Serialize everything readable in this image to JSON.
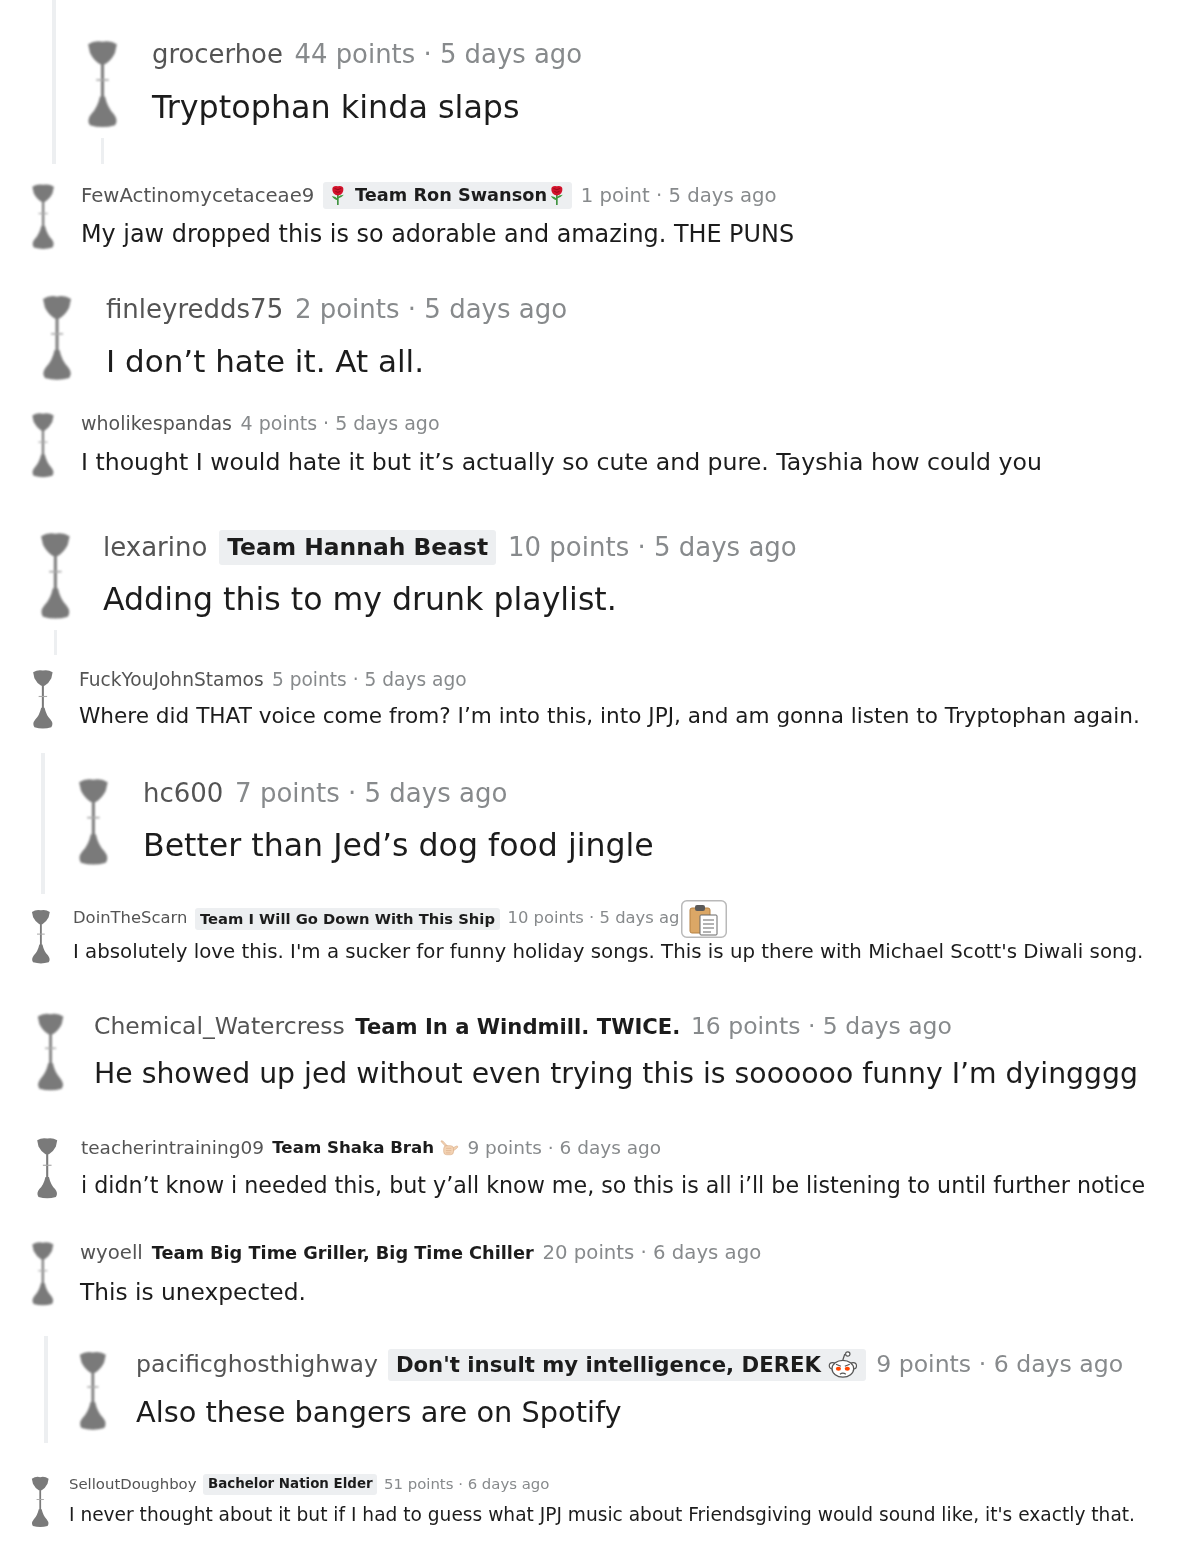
{
  "comments": [
    {
      "username": "grocerhoe",
      "meta": "44 points · 5 days ago",
      "text": "Tryptophan kinda slaps",
      "thread_line": true,
      "reply_line": true,
      "clipboard_popup": false
    },
    {
      "username": "FewActinomycetaceae9",
      "flair": {
        "text": "Team Ron Swanson",
        "badge": true,
        "icons_before": [
          {
            "kind": "rose"
          }
        ],
        "icons_after": [
          {
            "kind": "rose"
          }
        ]
      },
      "meta": "1 point · 5 days ago",
      "text": "My jaw dropped this is so adorable and amazing. THE PUNS",
      "thread_line": false,
      "reply_line": false,
      "clipboard_popup": false
    },
    {
      "username": "finleyredds75",
      "meta": "2 points · 5 days ago",
      "text": "I don’t hate it. At all.",
      "thread_line": false,
      "reply_line": false,
      "clipboard_popup": false
    },
    {
      "username": "wholikespandas",
      "meta": "4 points · 5 days ago",
      "text": "I thought I would hate it but it’s actually so cute and pure. Tayshia how could you",
      "thread_line": false,
      "reply_line": false,
      "clipboard_popup": false
    },
    {
      "username": "lexarino",
      "flair": {
        "text": "Team Hannah Beast",
        "badge": true
      },
      "meta": "10 points · 5 days ago",
      "text": "Adding this to my drunk playlist.",
      "thread_line": false,
      "reply_line": true,
      "clipboard_popup": false
    },
    {
      "username": "FuckYouJohnStamos",
      "meta": "5 points · 5 days ago",
      "text": "Where did THAT voice come from? I’m into this, into JPJ, and am gonna listen to Tryptophan again.",
      "thread_line": false,
      "reply_line": false,
      "clipboard_popup": false
    },
    {
      "username": "hc600",
      "meta": "7 points · 5 days ago",
      "text": "Better than Jed’s dog food jingle",
      "thread_line": true,
      "reply_line": false,
      "clipboard_popup": false
    },
    {
      "username": "DoinTheScarn",
      "flair": {
        "text": "Team I Will Go Down With This Ship",
        "badge": true
      },
      "meta": "10 points · 5 days ag",
      "text": "I absolutely love this. I'm a sucker for funny holiday songs. This is up there with Michael Scott's Diwali song.",
      "thread_line": false,
      "reply_line": false,
      "clipboard_popup": true
    },
    {
      "username": "Chemical_Watercress",
      "flair": {
        "text": "Team In a Windmill. TWICE.",
        "badge": false
      },
      "meta": "16 points · 5 days ago",
      "text": "He showed up jed without even trying this is soooooo funny I’m dyingggg",
      "thread_line": false,
      "reply_line": false,
      "clipboard_popup": false
    },
    {
      "username": "teacherintraining09",
      "flair": {
        "text": "Team Shaka Brah",
        "badge": false,
        "icons_after": [
          {
            "kind": "shaka"
          }
        ]
      },
      "meta": "9 points · 6 days ago",
      "text": "i didn’t know i needed this, but y’all know me, so this is all i’ll be listening to until further notice",
      "thread_line": false,
      "reply_line": false,
      "clipboard_popup": false
    },
    {
      "username": "wyoell",
      "flair": {
        "text": "Team Big Time Griller, Big Time Chiller",
        "badge": false
      },
      "meta": "20 points · 6 days ago",
      "text": "This is unexpected.",
      "thread_line": false,
      "reply_line": false,
      "clipboard_popup": false
    },
    {
      "username": "pacificghosthighway",
      "flair": {
        "text": "Don't insult my intelligence, DEREK",
        "badge": true,
        "icons_after": [
          {
            "kind": "snoo"
          }
        ]
      },
      "meta": "9 points · 6 days ago",
      "text": "Also these bangers are on Spotify",
      "thread_line": true,
      "reply_line": false,
      "clipboard_popup": false
    },
    {
      "username": "SelloutDoughboy",
      "flair": {
        "text": "Bachelor Nation Elder",
        "badge": true
      },
      "meta": "51 points · 6 days ago",
      "text": "I never thought about it but if I had to guess what JPJ music about Friendsgiving would sound like, it's exactly that.",
      "thread_line": false,
      "reply_line": false,
      "clipboard_popup": false
    }
  ]
}
